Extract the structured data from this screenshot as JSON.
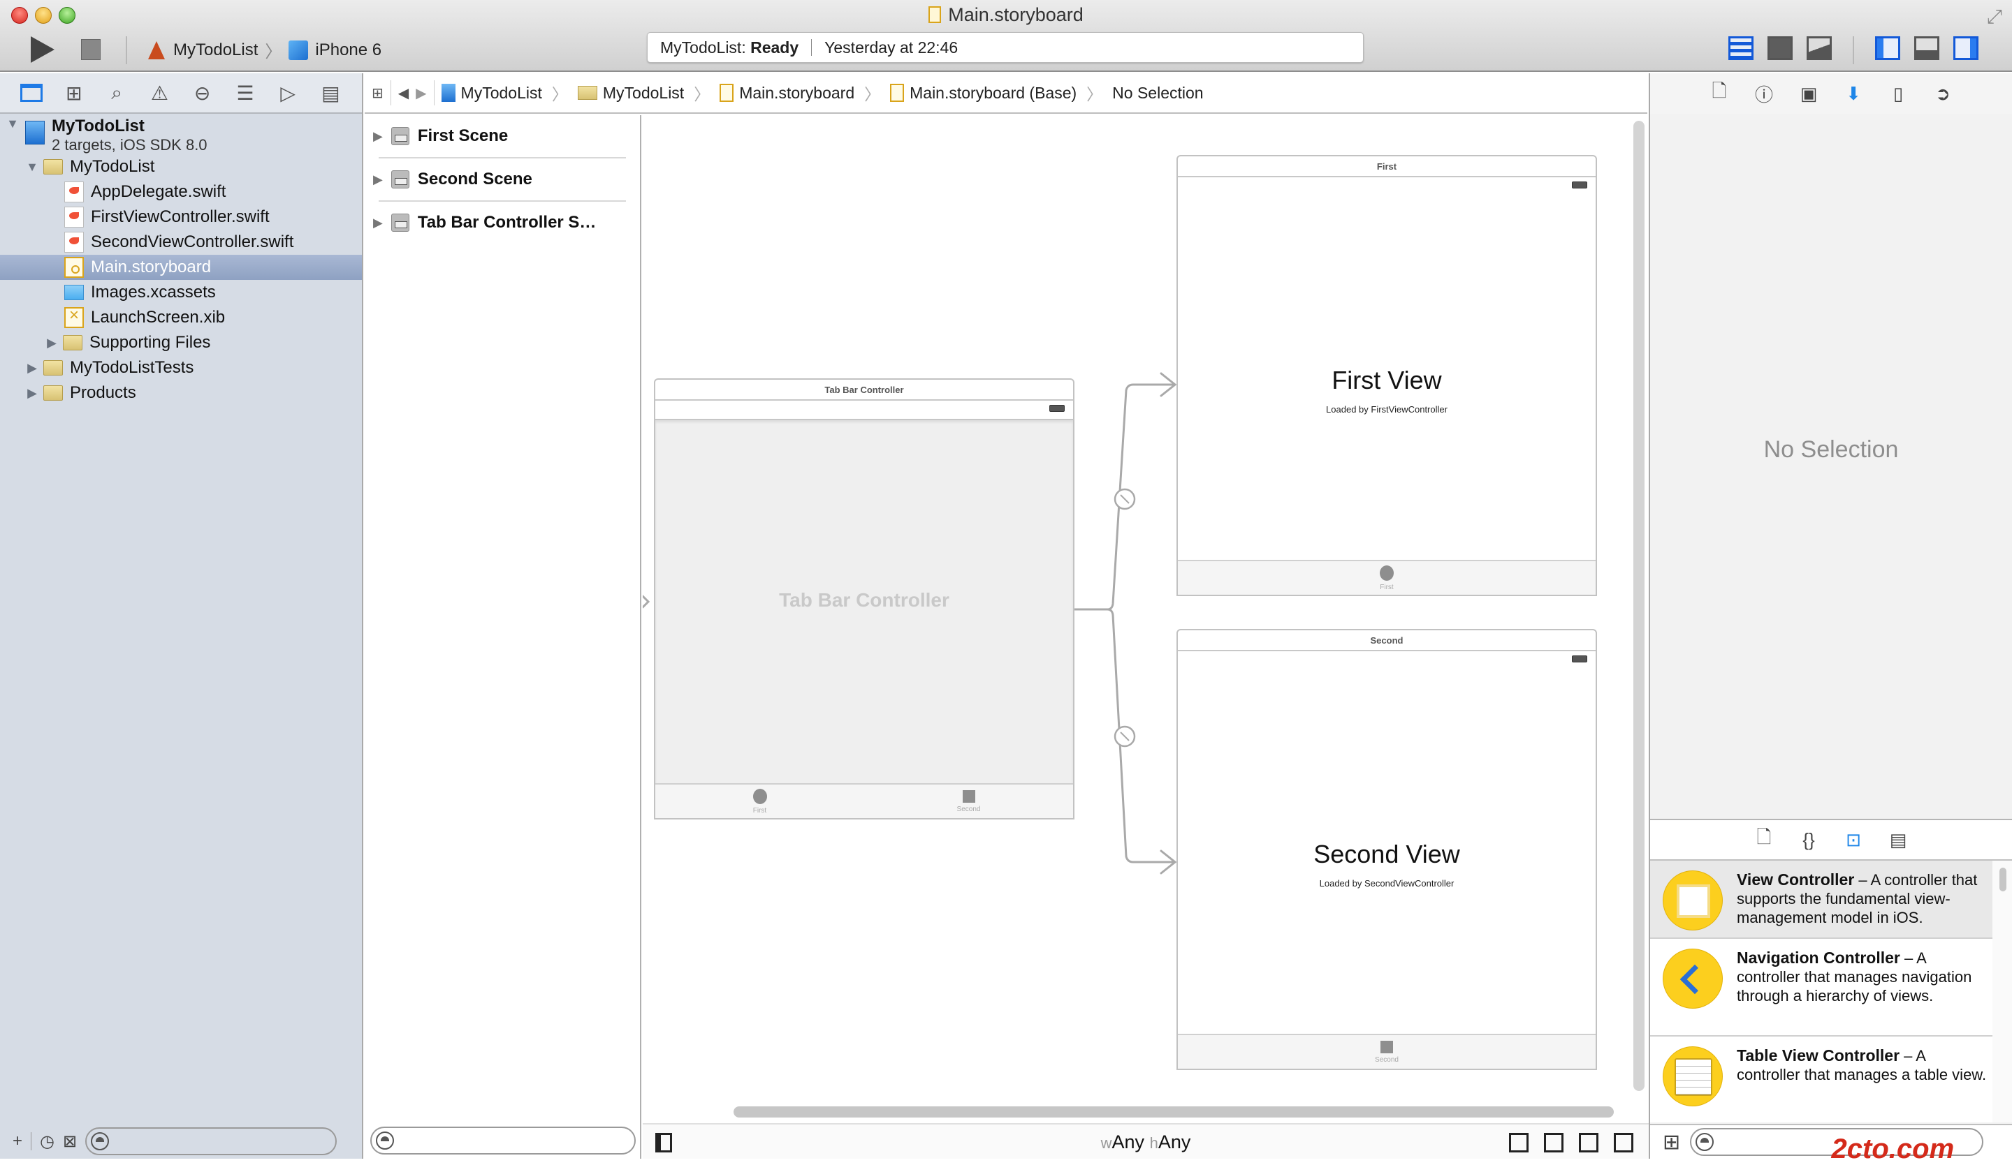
{
  "window": {
    "title": "Main.storyboard",
    "scheme": "MyTodoList",
    "device": "iPhone 6",
    "status_app": "MyTodoList:",
    "status_state": "Ready",
    "status_time": "Yesterday at 22:46"
  },
  "toolbar": {
    "icons": [
      "run-icon",
      "stop-icon",
      "standard-editor-icon",
      "assistant-editor-icon",
      "version-editor-icon",
      "navigator-panel-toggle-icon",
      "debug-area-toggle-icon",
      "utilities-panel-toggle-icon"
    ]
  },
  "navigator": {
    "tabs": [
      "project-navigator",
      "symbol-navigator",
      "find-navigator",
      "issue-navigator",
      "test-navigator",
      "debug-navigator",
      "breakpoint-navigator",
      "report-navigator"
    ],
    "project": {
      "name": "MyTodoList",
      "subtitle": "2 targets, iOS SDK 8.0"
    },
    "items": [
      {
        "label": "MyTodoList",
        "type": "folder",
        "level": 1,
        "expanded": true
      },
      {
        "label": "AppDelegate.swift",
        "type": "swift",
        "level": 2
      },
      {
        "label": "FirstViewController.swift",
        "type": "swift",
        "level": 2
      },
      {
        "label": "SecondViewController.swift",
        "type": "swift",
        "level": 2
      },
      {
        "label": "Main.storyboard",
        "type": "storyboard",
        "level": 2,
        "selected": true
      },
      {
        "label": "Images.xcassets",
        "type": "xcassets",
        "level": 2
      },
      {
        "label": "LaunchScreen.xib",
        "type": "xib",
        "level": 2
      },
      {
        "label": "Supporting Files",
        "type": "folder",
        "level": 2,
        "expanded": false
      },
      {
        "label": "MyTodoListTests",
        "type": "folder",
        "level": 1,
        "expanded": false
      },
      {
        "label": "Products",
        "type": "folder",
        "level": 1,
        "expanded": false
      }
    ],
    "filter_placeholder": ""
  },
  "jumpbar": {
    "crumbs": [
      "MyTodoList",
      "MyTodoList",
      "Main.storyboard",
      "Main.storyboard (Base)",
      "No Selection"
    ]
  },
  "outline": {
    "scenes": [
      "First Scene",
      "Second Scene",
      "Tab Bar Controller S…"
    ],
    "filter_placeholder": ""
  },
  "canvas": {
    "tab_bar_controller": {
      "title": "Tab Bar Controller",
      "placeholder": "Tab Bar Controller",
      "tabs": [
        "First",
        "Second"
      ]
    },
    "first_scene": {
      "title": "First",
      "heading": "First View",
      "subtitle": "Loaded by FirstViewController",
      "tab": "First"
    },
    "second_scene": {
      "title": "Second",
      "heading": "Second View",
      "subtitle": "Loaded by SecondViewController",
      "tab": "Second"
    },
    "size_class": {
      "w_prefix": "w",
      "w_value": "Any",
      "h_prefix": "h",
      "h_value": "Any"
    }
  },
  "inspector": {
    "tabs": [
      "file-inspector",
      "quick-help-inspector",
      "identity-inspector",
      "attributes-inspector",
      "size-inspector",
      "connections-inspector"
    ],
    "active_tab": "attributes-inspector",
    "empty_label": "No Selection",
    "library_tabs": [
      "file-template-library",
      "code-snippet-library",
      "object-library",
      "media-library"
    ],
    "library": [
      {
        "name": "View Controller",
        "desc": " – A controller that supports the fundamental view-management model in iOS."
      },
      {
        "name": "Navigation Controller",
        "desc": " – A controller that manages navigation through a hierarchy of views."
      },
      {
        "name": "Table View Controller",
        "desc": " – A controller that manages a table view."
      }
    ],
    "watermark": "2cto.com"
  },
  "colors": {
    "accent": "#1e7ae6",
    "selection": "#8ea1c2",
    "library_icon": "#fccf1e"
  }
}
